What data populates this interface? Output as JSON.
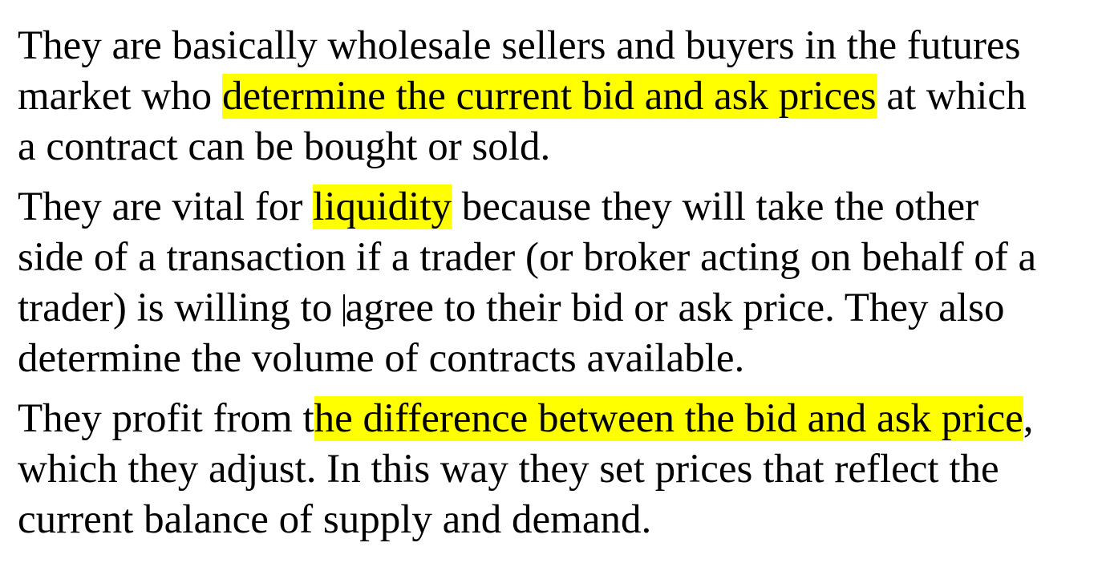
{
  "document": {
    "highlight_color": "#ffff00",
    "paragraphs": [
      {
        "lines": [
          {
            "segments": [
              {
                "text": "They are basically wholesale sellers and buyers in the futures",
                "highlight": false
              }
            ]
          },
          {
            "segments": [
              {
                "text": "market who ",
                "highlight": false
              },
              {
                "text": "determine the current bid and ask prices",
                "highlight": true
              },
              {
                "text": " at which",
                "highlight": false
              }
            ]
          },
          {
            "segments": [
              {
                "text": "a contract can be bought or sold.",
                "highlight": false
              }
            ]
          }
        ]
      },
      {
        "lines": [
          {
            "segments": [
              {
                "text": "They are vital for ",
                "highlight": false
              },
              {
                "text": "liquidity",
                "highlight": true
              },
              {
                "text": " because they will take the other",
                "highlight": false
              }
            ]
          },
          {
            "segments": [
              {
                "text": "side of a transaction if a trader (or broker acting on behalf of a",
                "highlight": false
              }
            ]
          },
          {
            "segments": [
              {
                "text": "trader) is willing to ",
                "highlight": false
              },
              {
                "caret": true
              },
              {
                "text": "agree to their bid or ask price. They also",
                "highlight": false
              }
            ]
          },
          {
            "segments": [
              {
                "text": "determine the volume of contracts available.",
                "highlight": false
              }
            ]
          }
        ]
      },
      {
        "lines": [
          {
            "segments": [
              {
                "text": "They profit from t",
                "highlight": false
              },
              {
                "text": "he difference between the bid and ask price",
                "highlight": true
              },
              {
                "text": ",",
                "highlight": false
              }
            ]
          },
          {
            "segments": [
              {
                "text": "which they adjust. In this way they set prices that reflect the",
                "highlight": false
              }
            ]
          },
          {
            "segments": [
              {
                "text": "current balance of supply and demand.",
                "highlight": false
              }
            ]
          }
        ]
      }
    ]
  }
}
